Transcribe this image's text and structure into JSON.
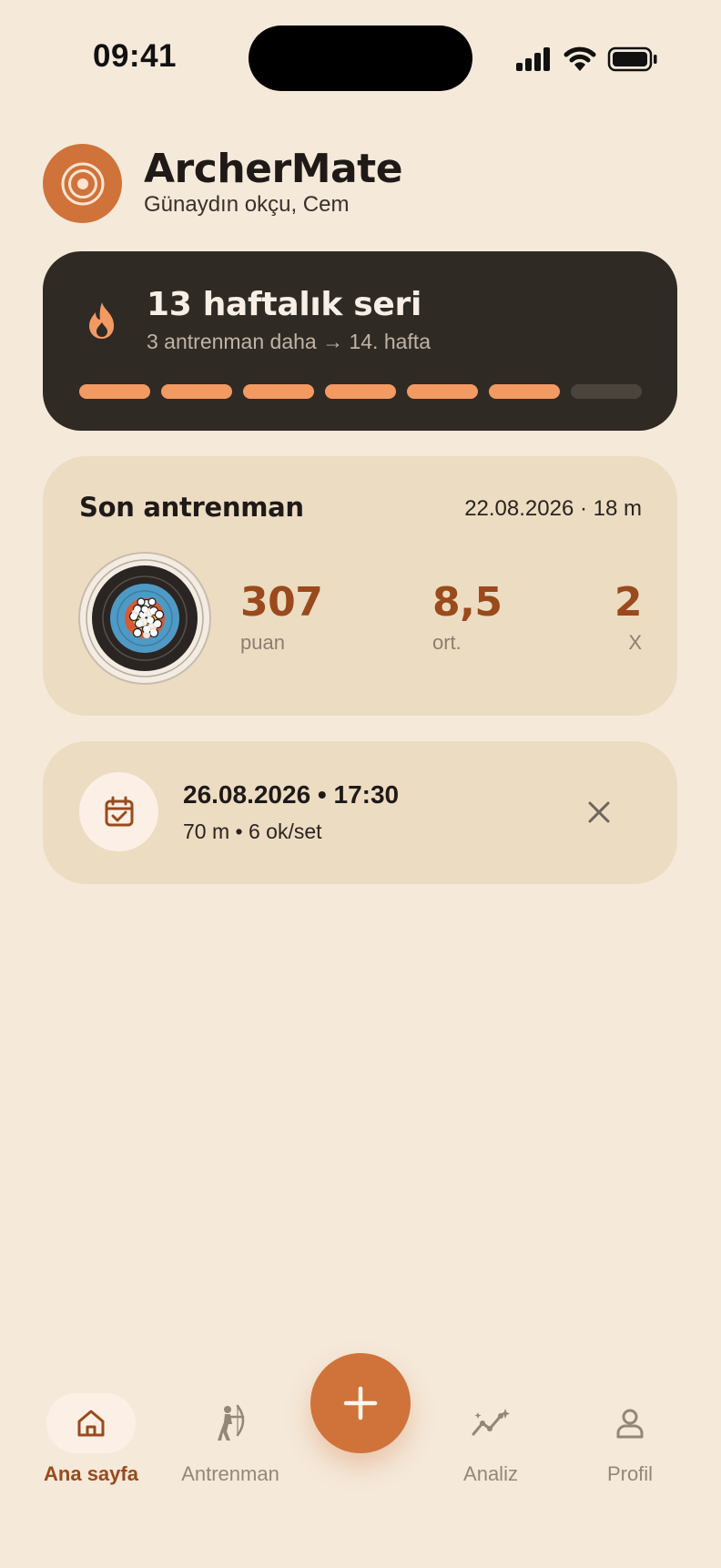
{
  "status_bar": {
    "time": "09:41",
    "icons": [
      "signal-icon",
      "wifi-icon",
      "battery-icon"
    ]
  },
  "header": {
    "app_name": "ArcherMate",
    "greeting": "Günaydın okçu, Cem",
    "logo_icon": "target-icon"
  },
  "streak": {
    "title": "13 haftalık seri",
    "subtitle": "3 antrenman daha → 14. hafta",
    "icon": "flame-icon",
    "segments_total": 7,
    "segments_filled": 6
  },
  "last_session": {
    "title": "Son antrenman",
    "meta": "22.08.2026 · 18 m",
    "stats": [
      {
        "value": "307",
        "label": "puan"
      },
      {
        "value": "8,5",
        "label": "ort."
      },
      {
        "value": "2",
        "label": "X"
      }
    ]
  },
  "upcoming": {
    "date_time": "26.08.2026 • 17:30",
    "details": "70 m • 6 ok/set",
    "icon": "calendar-check-icon"
  },
  "nav": {
    "items": [
      {
        "label": "Ana sayfa",
        "icon": "home-icon",
        "active": true
      },
      {
        "label": "Antrenman",
        "icon": "archer-icon",
        "active": false
      },
      {
        "label": "Analiz",
        "icon": "analytics-icon",
        "active": false
      },
      {
        "label": "Profil",
        "icon": "profile-icon",
        "active": false
      }
    ],
    "fab_icon": "plus-icon"
  },
  "colors": {
    "background": "#f5e9da",
    "accent": "#cf733a",
    "accent_dark": "#9a4a1c",
    "streak_bar": "#f39a62",
    "card": "#ecdcc2",
    "dark_card": "#2f2a24"
  }
}
